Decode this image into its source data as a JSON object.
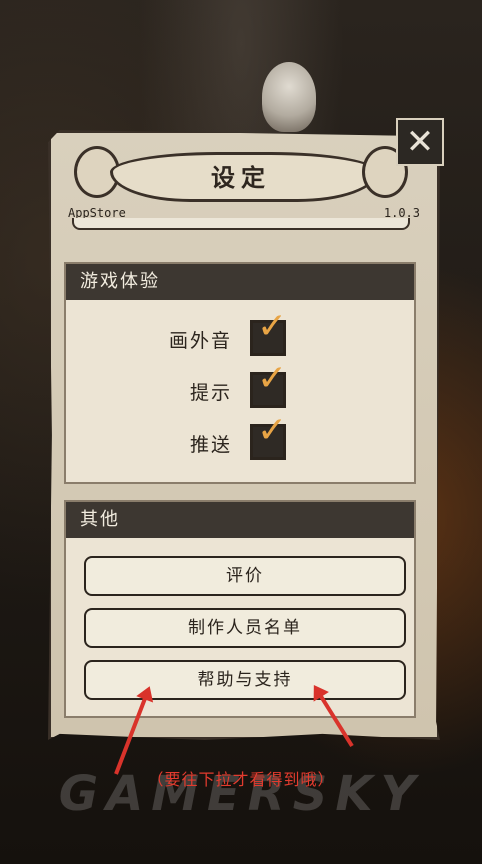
{
  "dialog": {
    "title": "设定",
    "store": "AppStore",
    "version": "1.0.3"
  },
  "sections": {
    "game": {
      "header": "游戏体验",
      "options": [
        {
          "label": "画外音",
          "checked": true
        },
        {
          "label": "提示",
          "checked": true
        },
        {
          "label": "推送",
          "checked": true
        }
      ]
    },
    "other": {
      "header": "其他",
      "buttons": [
        "评价",
        "制作人员名单",
        "帮助与支持"
      ]
    }
  },
  "overlay": {
    "note": "（要往下拉才看得到哦）",
    "watermark": "GAMERSKY",
    "arrow_color": "#d9332b"
  },
  "icons": {
    "close": "close-icon",
    "check": "check-icon"
  }
}
